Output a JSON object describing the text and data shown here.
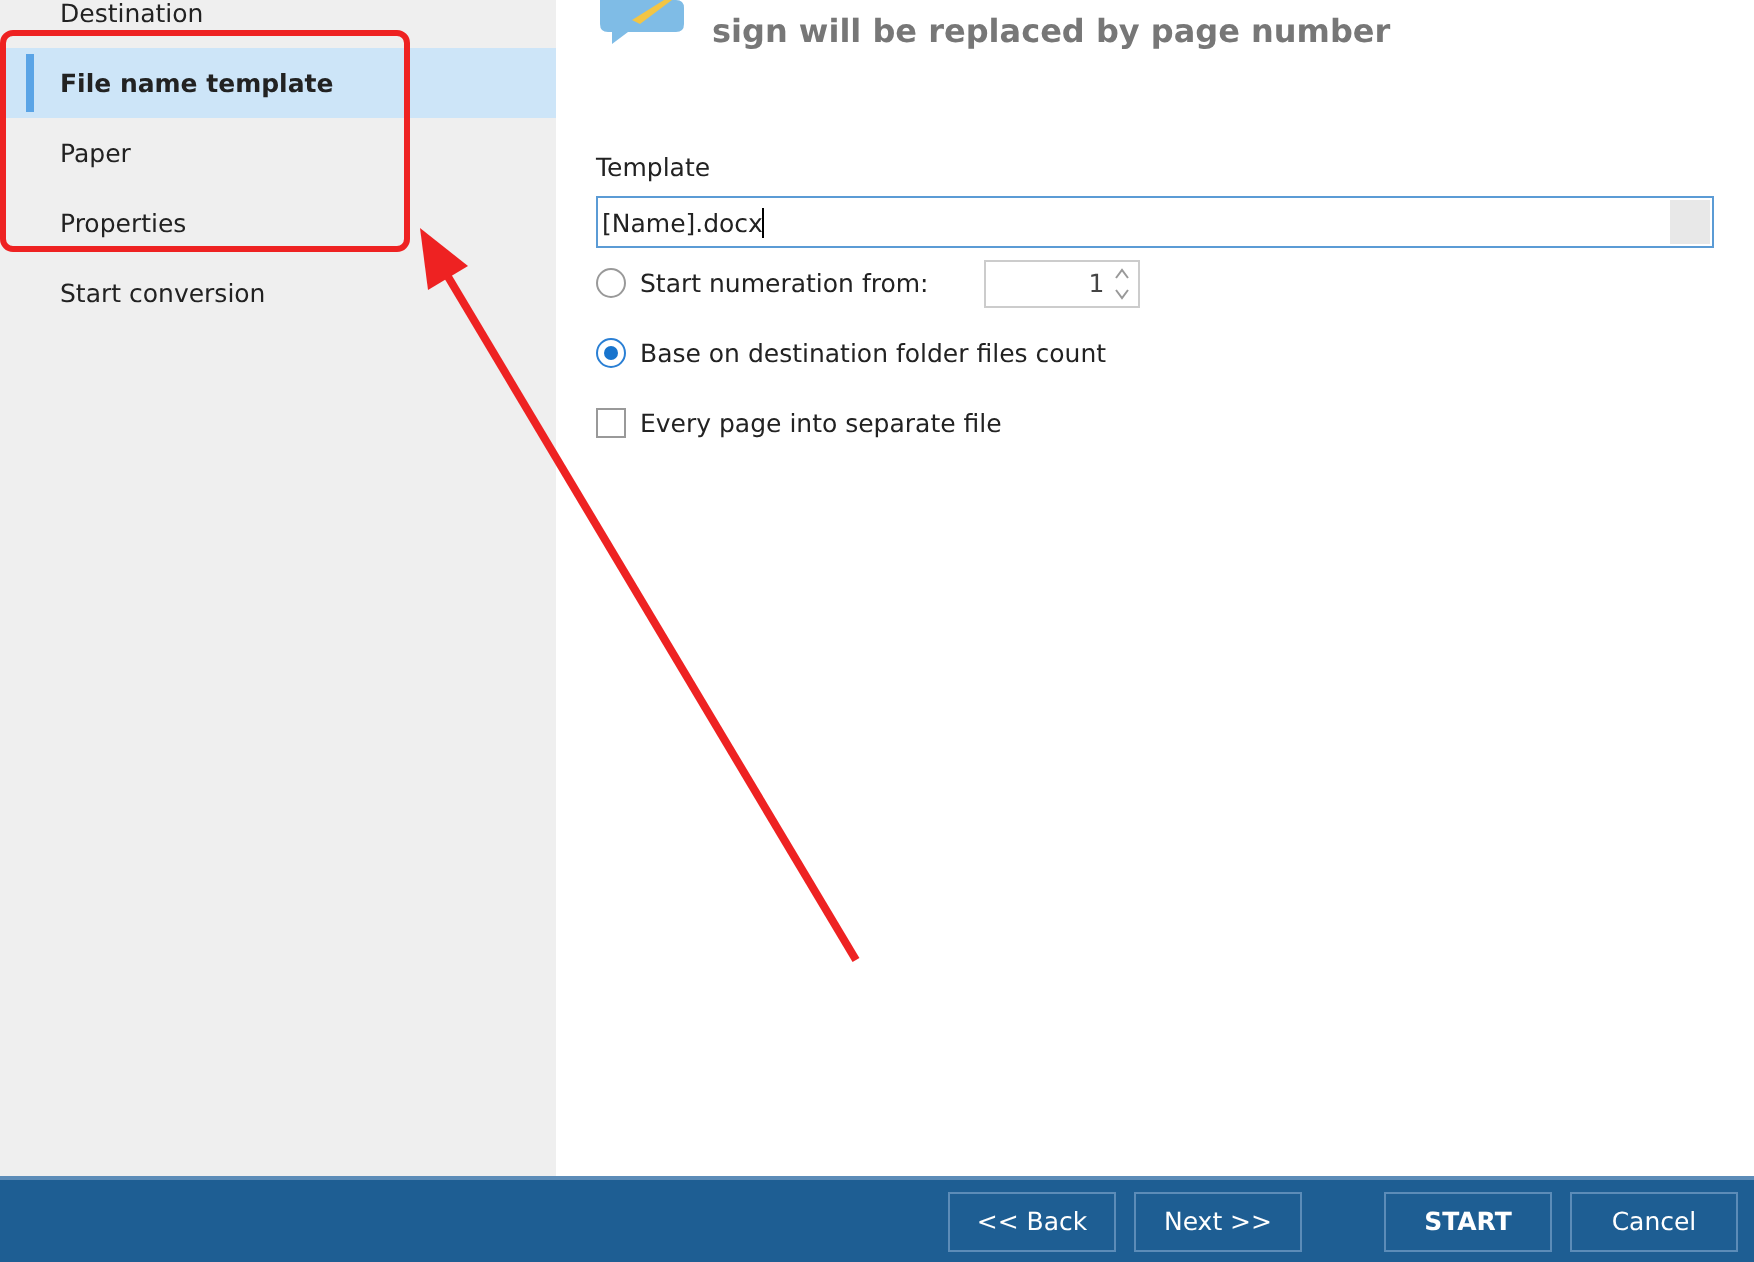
{
  "sidebar": {
    "items": [
      {
        "label": "Destination",
        "selected": false
      },
      {
        "label": "File name template",
        "selected": true
      },
      {
        "label": "Paper",
        "selected": false
      },
      {
        "label": "Properties",
        "selected": false
      },
      {
        "label": "Start conversion",
        "selected": false
      }
    ]
  },
  "header": {
    "text": "sign will be replaced by page number"
  },
  "template": {
    "label": "Template",
    "value": "[Name].docx"
  },
  "options": [
    {
      "kind": "radio",
      "label": "Start numeration from:",
      "selected": false,
      "spin_value": "1"
    },
    {
      "kind": "radio",
      "label": "Base on destination folder files count",
      "selected": true
    },
    {
      "kind": "checkbox",
      "label": "Every page into separate file",
      "checked": false
    }
  ],
  "footer": {
    "buttons": [
      {
        "label": "<< Back",
        "kind": "nav"
      },
      {
        "label": "Next >>",
        "kind": "nav"
      },
      {
        "label": "START",
        "kind": "primary"
      },
      {
        "label": "Cancel",
        "kind": "action"
      }
    ]
  }
}
